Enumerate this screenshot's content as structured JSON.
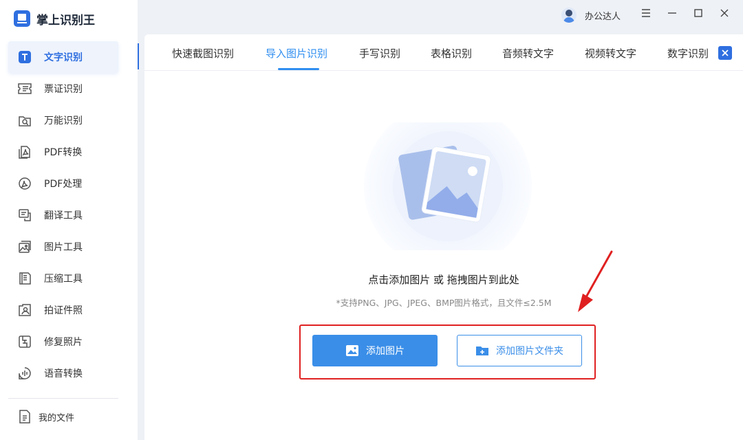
{
  "app": {
    "title": "掌上识别王"
  },
  "user": {
    "name": "办公达人"
  },
  "sidebar": {
    "items": [
      {
        "label": "文字识别",
        "icon": "text-recognition-icon",
        "active": true
      },
      {
        "label": "票证识别",
        "icon": "ticket-icon"
      },
      {
        "label": "万能识别",
        "icon": "universal-scan-icon"
      },
      {
        "label": "PDF转换",
        "icon": "pdf-convert-icon"
      },
      {
        "label": "PDF处理",
        "icon": "pdf-process-icon"
      },
      {
        "label": "翻译工具",
        "icon": "translate-icon"
      },
      {
        "label": "图片工具",
        "icon": "image-tool-icon"
      },
      {
        "label": "压缩工具",
        "icon": "compress-icon"
      },
      {
        "label": "拍证件照",
        "icon": "id-photo-icon"
      },
      {
        "label": "修复照片",
        "icon": "photo-repair-icon"
      },
      {
        "label": "语音转换",
        "icon": "voice-convert-icon"
      }
    ],
    "my_files": "我的文件"
  },
  "tabs": [
    {
      "label": "快速截图识别"
    },
    {
      "label": "导入图片识别",
      "active": true
    },
    {
      "label": "手写识别"
    },
    {
      "label": "表格识别"
    },
    {
      "label": "音频转文字"
    },
    {
      "label": "视频转文字"
    },
    {
      "label": "数字识别"
    }
  ],
  "upload": {
    "hint": "点击添加图片 或 拖拽图片到此处",
    "formats": "*支持PNG、JPG、JPEG、BMP图片格式，且文件≤2.5M",
    "add_image": "添加图片",
    "add_folder": "添加图片文件夹"
  },
  "colors": {
    "accent": "#2f8ef0",
    "brand": "#2f6fe0",
    "annotation": "#e02020"
  }
}
